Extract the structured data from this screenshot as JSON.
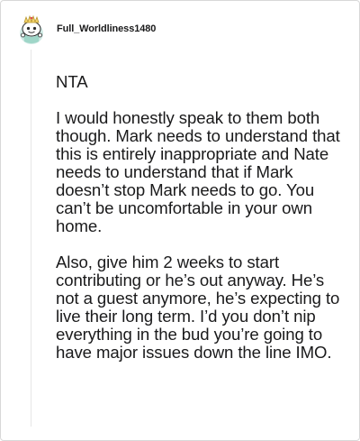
{
  "comment": {
    "username": "Full_Worldliness1480",
    "avatar_icon": "snoo-avatar-icon",
    "paragraphs": [
      "NTA",
      "I would honestly speak to them both though. Mark needs to understand that this is entirely inappropriate and Nate needs to understand that if Mark doesn’t stop Mark needs to go. You can’t be uncomfortable in your own home.",
      "Also, give him 2 weeks to start contributing or he’s out anyway. He’s not a guest anymore, he’s expecting to live their long term. I’d you don’t nip everything in the bud you’re going to have major issues down the line IMO."
    ]
  }
}
